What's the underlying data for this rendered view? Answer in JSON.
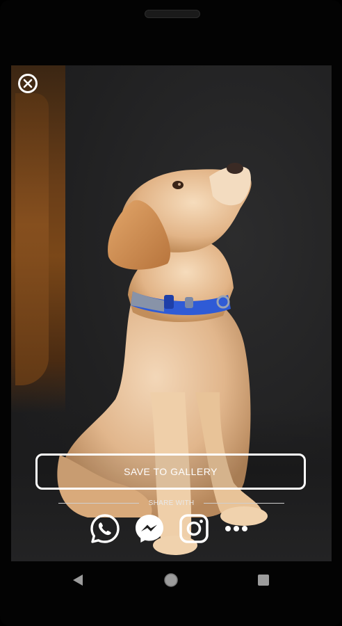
{
  "viewer": {
    "close_icon": "close-circle-icon"
  },
  "actions": {
    "save_label": "SAVE TO GALLERY",
    "share_label": "SHARE WITH",
    "share_targets": [
      "whatsapp-icon",
      "messenger-icon",
      "instagram-icon",
      "more-dots-icon"
    ]
  },
  "system_nav": {
    "back": "back-triangle-icon",
    "home": "home-circle-icon",
    "recent": "recent-square-icon"
  },
  "colors": {
    "frame": "#030303",
    "button_border": "#ffffff",
    "collar": "#2f5bd6"
  }
}
